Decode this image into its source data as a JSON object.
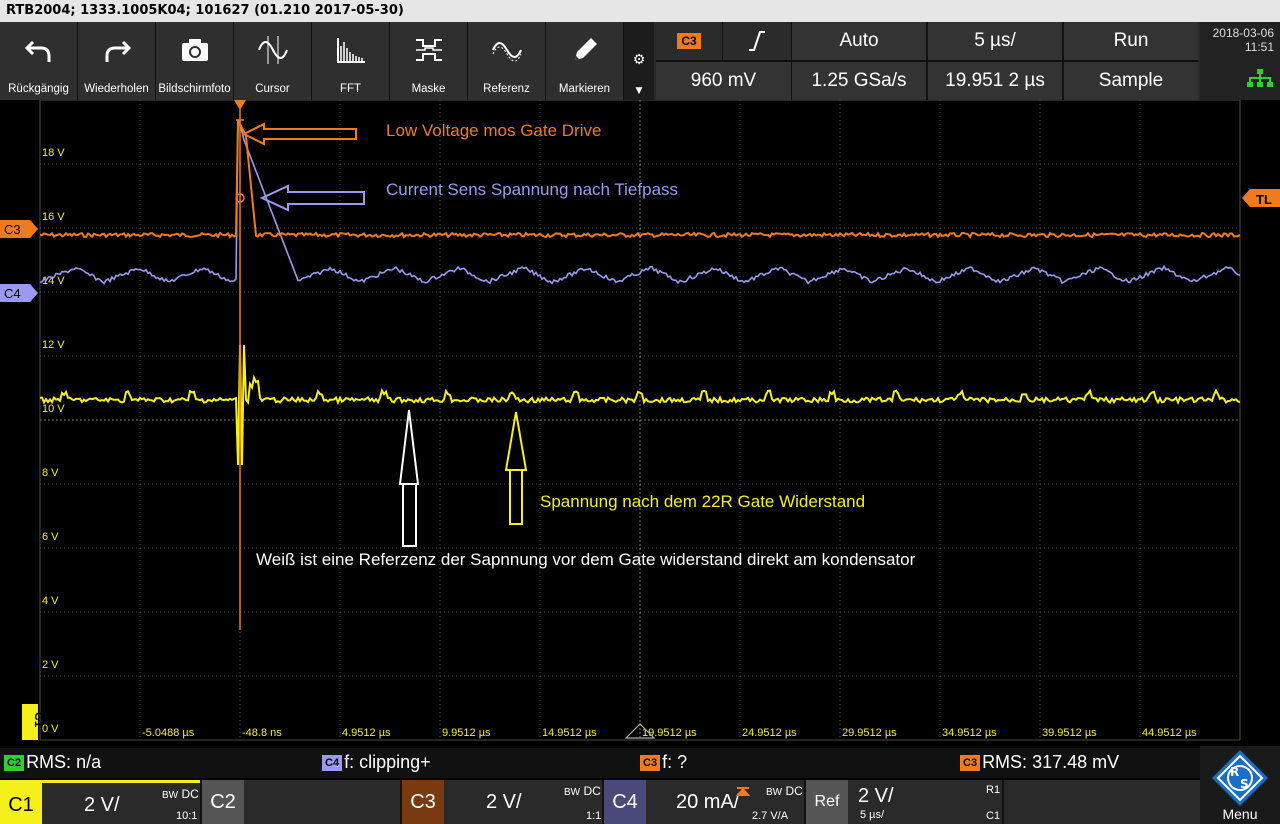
{
  "title": "RTB2004; 1333.1005K04; 101627 (01.210 2017-05-30)",
  "toolbar": [
    {
      "label": "Rückgängig",
      "icon": "undo-icon"
    },
    {
      "label": "Wiederholen",
      "icon": "redo-icon"
    },
    {
      "label": "Bildschirmfoto",
      "icon": "camera-icon"
    },
    {
      "label": "Cursor",
      "icon": "cursor-wave-icon"
    },
    {
      "label": "FFT",
      "icon": "fft-icon"
    },
    {
      "label": "Maske",
      "icon": "mask-icon"
    },
    {
      "label": "Referenz",
      "icon": "reference-wave-icon"
    },
    {
      "label": "Markieren",
      "icon": "pencil-icon"
    }
  ],
  "settings": {
    "trigger_source": "C3",
    "trigger_mode": "Auto",
    "timebase": "5 µs/",
    "run_state": "Run",
    "trigger_level": "960 mV",
    "sample_rate": "1.25 GSa/s",
    "trigger_position": "19.951 2 µs",
    "acquisition": "Sample"
  },
  "datetime": {
    "date": "2018-03-06",
    "time": "11:51"
  },
  "y_ticks": [
    "18 V",
    "16 V",
    "14 V",
    "12 V",
    "10 V",
    "8 V",
    "6 V",
    "4 V",
    "2 V",
    "0 V"
  ],
  "x_ticks": [
    "-5.0488 µs",
    "-48.8 ns",
    "4.9512 µs",
    "9.9512 µs",
    "14.9512 µs",
    "19.9512 µs",
    "24.9512 µs",
    "29.9512 µs",
    "34.9512 µs",
    "39.9512 µs",
    "44.9512 µs"
  ],
  "markers": {
    "c3": "C3",
    "c4": "C4",
    "tl": "TL",
    "c1": "C1"
  },
  "annotations": {
    "orange": "Low Voltage mos Gate Drive",
    "blue": "Current Sens Spannung nach Tiefpass",
    "yellow": "Spannung nach dem 22R Gate Widerstand",
    "white": "Weiß ist eine Referzenz der Sapnnung vor dem Gate widerstand direkt am kondensator"
  },
  "measurements": [
    {
      "badge": "C2",
      "text": "RMS: n/a",
      "color": "#2fd12f"
    },
    {
      "badge": "C4",
      "text": "f: clipping+",
      "color": "#9a9af0"
    },
    {
      "badge": "C3",
      "text": "f: ?",
      "color": "#f07b1c"
    },
    {
      "badge": "C3",
      "text": "RMS: 317.48 mV",
      "color": "#f07b1c"
    }
  ],
  "channels": {
    "c1": {
      "label": "C1",
      "scale": "2 V/",
      "coupling": "DC",
      "ratio": "10:1"
    },
    "c2": {
      "label": "C2"
    },
    "c3": {
      "label": "C3",
      "scale": "2 V/",
      "coupling": "DC",
      "ratio": "1:1"
    },
    "c4": {
      "label": "C4",
      "scale": "20 mA/",
      "coupling": "DC",
      "ratio": "2.7 V/A"
    },
    "ref": {
      "label": "Ref",
      "scale": "2 V/",
      "time": "5 µs/",
      "src1": "R1",
      "src2": "C1"
    }
  },
  "bw_label": "BW",
  "menu_label": "Menu",
  "colors": {
    "c1": "#f5f01a",
    "c3": "#f07b1c",
    "c4": "#9a9af0",
    "grid": "#555555"
  }
}
